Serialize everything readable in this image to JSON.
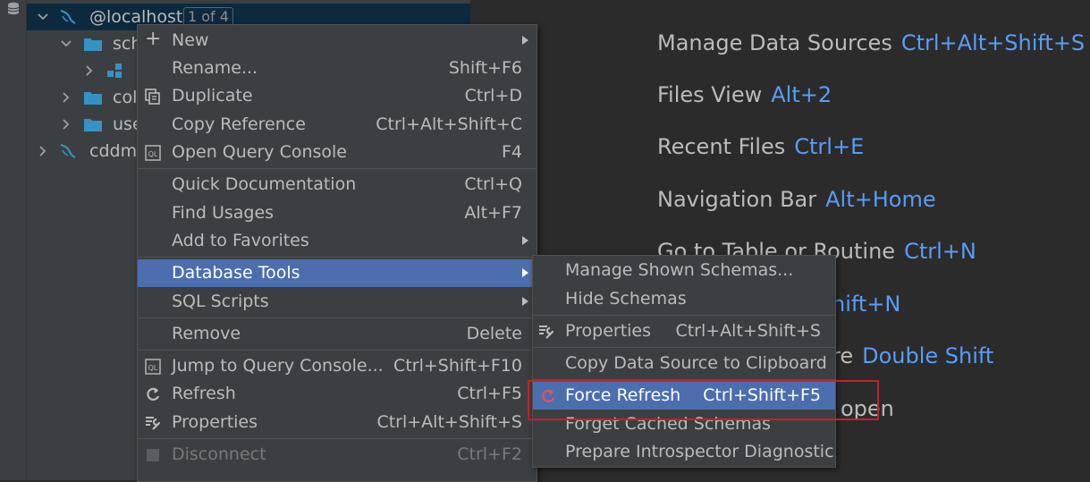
{
  "tree": {
    "root_label": "@localhost",
    "root_badge": "1 of 4",
    "children": [
      "sch",
      "col",
      "use"
    ],
    "second_root": "cddmc"
  },
  "welcome": {
    "items": [
      {
        "label": "Manage Data Sources",
        "shortcut": "Ctrl+Alt+Shift+S"
      },
      {
        "label": "Files View",
        "shortcut": "Alt+2"
      },
      {
        "label": "Recent Files",
        "shortcut": "Ctrl+E"
      },
      {
        "label": "Navigation Bar",
        "shortcut": "Alt+Home"
      },
      {
        "label": "Go to Table or Routine",
        "shortcut": "Ctrl+N"
      },
      {
        "label": "",
        "shortcut": "hift+N"
      },
      {
        "label": "re",
        "shortcut": "Double Shift"
      },
      {
        "label": "open",
        "shortcut": ""
      }
    ]
  },
  "context_menu": {
    "new": "New",
    "rename": "Rename...",
    "rename_sc": "Shift+F6",
    "duplicate": "Duplicate",
    "duplicate_sc": "Ctrl+D",
    "copy_ref": "Copy Reference",
    "copy_ref_sc": "Ctrl+Alt+Shift+C",
    "open_console": "Open Query Console",
    "open_console_sc": "F4",
    "quick_doc": "Quick Documentation",
    "quick_doc_sc": "Ctrl+Q",
    "find_usages": "Find Usages",
    "find_usages_sc": "Alt+F7",
    "add_fav": "Add to Favorites",
    "db_tools": "Database Tools",
    "sql_scripts": "SQL Scripts",
    "remove": "Remove",
    "remove_sc": "Delete",
    "jump_console": "Jump to Query Console...",
    "jump_console_sc": "Ctrl+Shift+F10",
    "refresh": "Refresh",
    "refresh_sc": "Ctrl+F5",
    "properties": "Properties",
    "properties_sc": "Ctrl+Alt+Shift+S",
    "disconnect": "Disconnect",
    "disconnect_sc": "Ctrl+F2"
  },
  "submenu": {
    "manage_schemas": "Manage Shown Schemas...",
    "hide_schemas": "Hide Schemas",
    "properties": "Properties",
    "properties_sc": "Ctrl+Alt+Shift+S",
    "copy_ds": "Copy Data Source to Clipboard",
    "force_refresh": "Force Refresh",
    "force_refresh_sc": "Ctrl+Shift+F5",
    "forget_cached": "Forget Cached Schemas",
    "prepare_diag": "Prepare Introspector Diagnostic"
  },
  "colors": {
    "highlight": "#4b6eaf",
    "shortcut_blue": "#589df6",
    "annotation_red": "#c8202b"
  }
}
